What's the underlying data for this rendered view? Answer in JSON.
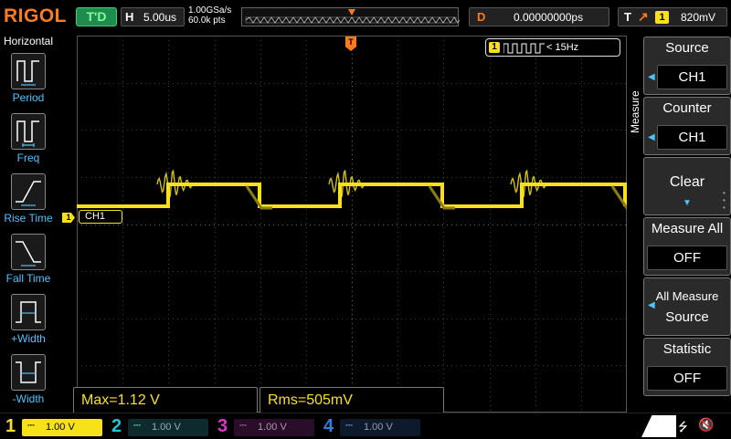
{
  "brand": "RIGOL",
  "status": {
    "run_state": "T'D"
  },
  "horizontal": {
    "label": "H",
    "timebase": "5.00us",
    "sample_rate": "1.00GSa/s",
    "memory_depth": "60.0k pts"
  },
  "delay": {
    "label": "D",
    "value": "0.00000000ps"
  },
  "trigger": {
    "label": "T",
    "edge_icon": "rising-edge-icon",
    "source": "1",
    "level": "820mV"
  },
  "left_menu": {
    "title": "Horizontal",
    "items": [
      {
        "label": "Period",
        "icon": "period-icon"
      },
      {
        "label": "Freq",
        "icon": "frequency-icon"
      },
      {
        "label": "Rise Time",
        "icon": "rise-time-icon"
      },
      {
        "label": "Fall Time",
        "icon": "fall-time-icon"
      },
      {
        "label": "+Width",
        "icon": "positive-width-icon"
      },
      {
        "label": "-Width",
        "icon": "negative-width-icon"
      }
    ]
  },
  "screen": {
    "freq_counter": {
      "channel": "1",
      "text": "< 15Hz"
    },
    "ch1_label": "CH1",
    "ch1_marker": "1",
    "trigger_marker": "T"
  },
  "measurements": [
    {
      "text": "Max=1.12 V"
    },
    {
      "text": "Rms=505mV"
    }
  ],
  "right_menu": {
    "title": "Measure",
    "buttons": [
      {
        "title": "Source",
        "value": "CH1"
      },
      {
        "title": "Counter",
        "value": "CH1"
      },
      {
        "title": "Clear",
        "value": ""
      },
      {
        "title": "Measure All",
        "value": "OFF"
      },
      {
        "title": "All Measure",
        "value": "Source"
      },
      {
        "title": "Statistic",
        "value": "OFF"
      }
    ]
  },
  "channels": [
    {
      "num": "1",
      "volts": "1.00 V",
      "color": "#f7e21a",
      "active": true
    },
    {
      "num": "2",
      "volts": "1.00 V",
      "color": "#1fc8d6",
      "active": false
    },
    {
      "num": "3",
      "volts": "1.00 V",
      "color": "#d63ac8",
      "active": false
    },
    {
      "num": "4",
      "volts": "1.00 V",
      "color": "#2b7fe0",
      "active": false
    }
  ],
  "colors": {
    "ch1": "#f7e21a",
    "trigger": "#ff7a1a",
    "accent": "#4fc3ff"
  }
}
